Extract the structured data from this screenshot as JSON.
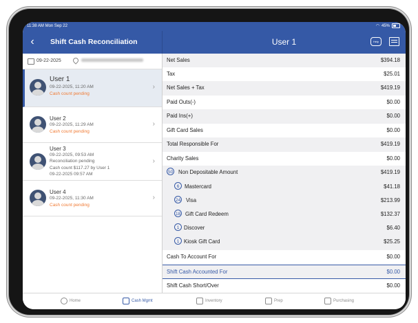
{
  "status_bar": {
    "time": "11:38 AM  Mon Sep 22",
    "wifi_icon": "wifi-icon",
    "battery": "45%"
  },
  "header": {
    "back_icon": "chevron-left-icon",
    "left_title": "Shift Cash Reconciliation",
    "right_title": "User 1",
    "help_icon": "help-chat-icon",
    "report_icon": "report-icon"
  },
  "date_bar": {
    "date": "09-22-2025"
  },
  "users": [
    {
      "name": "User 1",
      "datetime": "09-22-2025, 11:20 AM",
      "status": "Cash count pending"
    },
    {
      "name": "User 2",
      "datetime": "09-22-2025, 11:29 AM",
      "status": "Cash count pending"
    },
    {
      "name": "User 3",
      "datetime": "09-22-2025, 09:53 AM",
      "status": "Reconciliation pending",
      "extra1": "Cash count $117.27 by User 1",
      "extra2": "09-22-2025 09:57 AM"
    },
    {
      "name": "User 4",
      "datetime": "09-22-2025, 11:30 AM",
      "status": "Cash count pending"
    }
  ],
  "summary": {
    "net_sales": {
      "label": "Net Sales",
      "value": "$394.18"
    },
    "tax": {
      "label": "Tax",
      "value": "$25.01"
    },
    "net_sales_tax": {
      "label": "Net Sales + Tax",
      "value": "$419.19"
    },
    "paid_outs": {
      "label": "Paid Outs(-)",
      "value": "$0.00"
    },
    "paid_ins": {
      "label": "Paid Ins(+)",
      "value": "$0.00"
    },
    "gift_card_sales": {
      "label": "Gift Card Sales",
      "value": "$0.00"
    },
    "total_responsible": {
      "label": "Total Responsible For",
      "value": "$419.19"
    },
    "charity_sales": {
      "label": "Charity Sales",
      "value": "$0.00"
    },
    "non_depositable": {
      "count": "50",
      "label": "Non Depositable Amount",
      "value": "$419.19"
    },
    "mastercard": {
      "count": "6",
      "label": "Mastercard",
      "value": "$41.18"
    },
    "visa": {
      "count": "24",
      "label": "Visa",
      "value": "$213.99"
    },
    "gift_card_redeem": {
      "count": "18",
      "label": "Gift Card Redeem",
      "value": "$132.37"
    },
    "discover": {
      "count": "1",
      "label": "Discover",
      "value": "$6.40"
    },
    "kiosk_gift_card": {
      "count": "1",
      "label": "Kiosk Gift Card",
      "value": "$25.25"
    },
    "cash_to_account": {
      "label": "Cash To Account For",
      "value": "$0.00"
    },
    "shift_cash_accounted": {
      "label": "Shift Cash Accounted For",
      "value": "$0.00"
    },
    "shift_cash_short_over": {
      "label": "Shift Cash Short/Over",
      "value": "$0.00"
    }
  },
  "tabs": [
    {
      "label": "Home",
      "icon": "home-icon"
    },
    {
      "label": "Cash Mgmt",
      "icon": "cash-register-icon"
    },
    {
      "label": "Inventory",
      "icon": "warehouse-icon"
    },
    {
      "label": "Prep",
      "icon": "prep-icon"
    },
    {
      "label": "Purchasing",
      "icon": "purchasing-icon"
    }
  ],
  "colors": {
    "primary": "#3559a6",
    "pending": "#f07a33",
    "row_alt": "#f0f0f2",
    "selected": "#e6ebf2"
  }
}
